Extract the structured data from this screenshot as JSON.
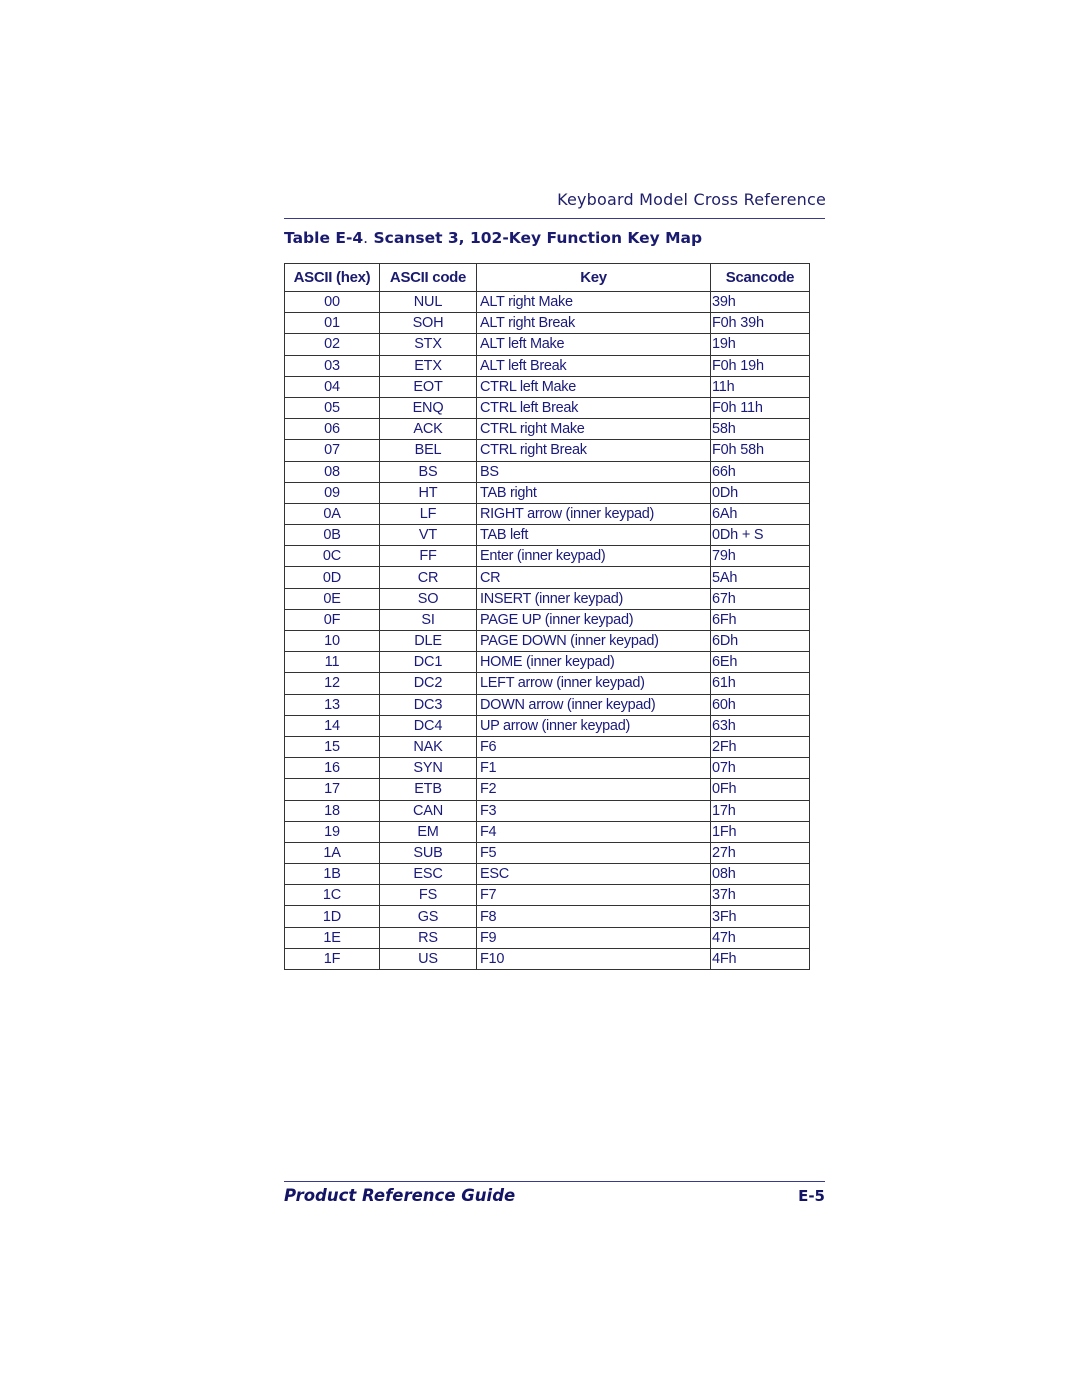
{
  "header": {
    "running_title": "Keyboard Model Cross Reference"
  },
  "table": {
    "title_label": "Table E-4",
    "title_sep": ".",
    "title_text": " Scanset 3, 102-Key Function Key Map",
    "columns": [
      "ASCII (hex)",
      "ASCII code",
      "Key",
      "Scancode"
    ],
    "rows": [
      [
        "00",
        "NUL",
        "ALT right Make",
        "39h"
      ],
      [
        "01",
        "SOH",
        "ALT right Break",
        "F0h 39h"
      ],
      [
        "02",
        "STX",
        "ALT left Make",
        "19h"
      ],
      [
        "03",
        "ETX",
        "ALT left Break",
        "F0h 19h"
      ],
      [
        "04",
        "EOT",
        "CTRL left Make",
        "11h"
      ],
      [
        "05",
        "ENQ",
        "CTRL left Break",
        "F0h 11h"
      ],
      [
        "06",
        "ACK",
        "CTRL right Make",
        "58h"
      ],
      [
        "07",
        "BEL",
        "CTRL right Break",
        "F0h 58h"
      ],
      [
        "08",
        "BS",
        "BS",
        "66h"
      ],
      [
        "09",
        "HT",
        "TAB right",
        "0Dh"
      ],
      [
        "0A",
        "LF",
        "RIGHT arrow (inner keypad)",
        "6Ah"
      ],
      [
        "0B",
        "VT",
        "TAB left",
        "0Dh + S"
      ],
      [
        "0C",
        "FF",
        "Enter (inner keypad)",
        "79h"
      ],
      [
        "0D",
        "CR",
        "CR",
        "5Ah"
      ],
      [
        "0E",
        "SO",
        "INSERT (inner keypad)",
        "67h"
      ],
      [
        "0F",
        "SI",
        "PAGE UP (inner keypad)",
        "6Fh"
      ],
      [
        "10",
        "DLE",
        "PAGE DOWN (inner keypad)",
        "6Dh"
      ],
      [
        "11",
        "DC1",
        "HOME (inner keypad)",
        "6Eh"
      ],
      [
        "12",
        "DC2",
        "LEFT arrow (inner keypad)",
        "61h"
      ],
      [
        "13",
        "DC3",
        "DOWN arrow (inner keypad)",
        "60h"
      ],
      [
        "14",
        "DC4",
        "UP arrow (inner keypad)",
        "63h"
      ],
      [
        "15",
        "NAK",
        "F6",
        "2Fh"
      ],
      [
        "16",
        "SYN",
        "F1",
        "07h"
      ],
      [
        "17",
        "ETB",
        "F2",
        "0Fh"
      ],
      [
        "18",
        "CAN",
        "F3",
        "17h"
      ],
      [
        "19",
        "EM",
        "F4",
        "1Fh"
      ],
      [
        "1A",
        "SUB",
        "F5",
        "27h"
      ],
      [
        "1B",
        "ESC",
        "ESC",
        "08h"
      ],
      [
        "1C",
        "FS",
        "F7",
        "37h"
      ],
      [
        "1D",
        "GS",
        "F8",
        "3Fh"
      ],
      [
        "1E",
        "RS",
        "F9",
        "47h"
      ],
      [
        "1F",
        "US",
        "F10",
        "4Fh"
      ]
    ]
  },
  "footer": {
    "guide_title": "Product Reference Guide",
    "page_number": "E-5"
  }
}
